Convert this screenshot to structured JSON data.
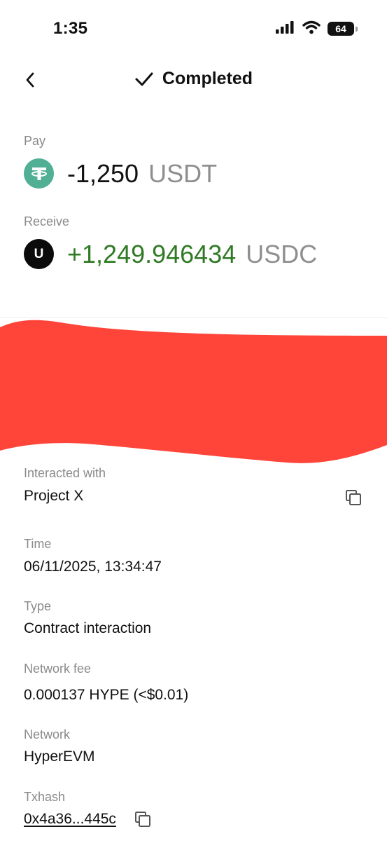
{
  "status_bar": {
    "time": "1:35",
    "battery": "64"
  },
  "header": {
    "title": "Completed"
  },
  "pay": {
    "label": "Pay",
    "amount": "-1,250",
    "unit": "USDT"
  },
  "receive": {
    "label": "Receive",
    "amount": "+1,249.946434",
    "unit": "USDC",
    "icon_letter": "U"
  },
  "details": {
    "interacted": {
      "label": "Interacted with",
      "value": "Project X"
    },
    "time": {
      "label": "Time",
      "value": "06/11/2025, 13:34:47"
    },
    "type": {
      "label": "Type",
      "value": "Contract interaction"
    },
    "fee": {
      "label": "Network fee",
      "value": "0.000137 HYPE (<$0.01)"
    },
    "network": {
      "label": "Network",
      "value": "HyperEVM"
    },
    "txhash": {
      "label": "Txhash",
      "value": "0x4a36...445c"
    }
  },
  "colors": {
    "positive": "#2f7a24",
    "usdt": "#50af95",
    "redaction": "#ff4439",
    "muted": "#8a8a8a"
  },
  "icons": [
    "cellular-signal-icon",
    "wifi-icon",
    "battery-icon",
    "back-chevron-icon",
    "checkmark-icon",
    "tether-icon",
    "copy-icon"
  ]
}
